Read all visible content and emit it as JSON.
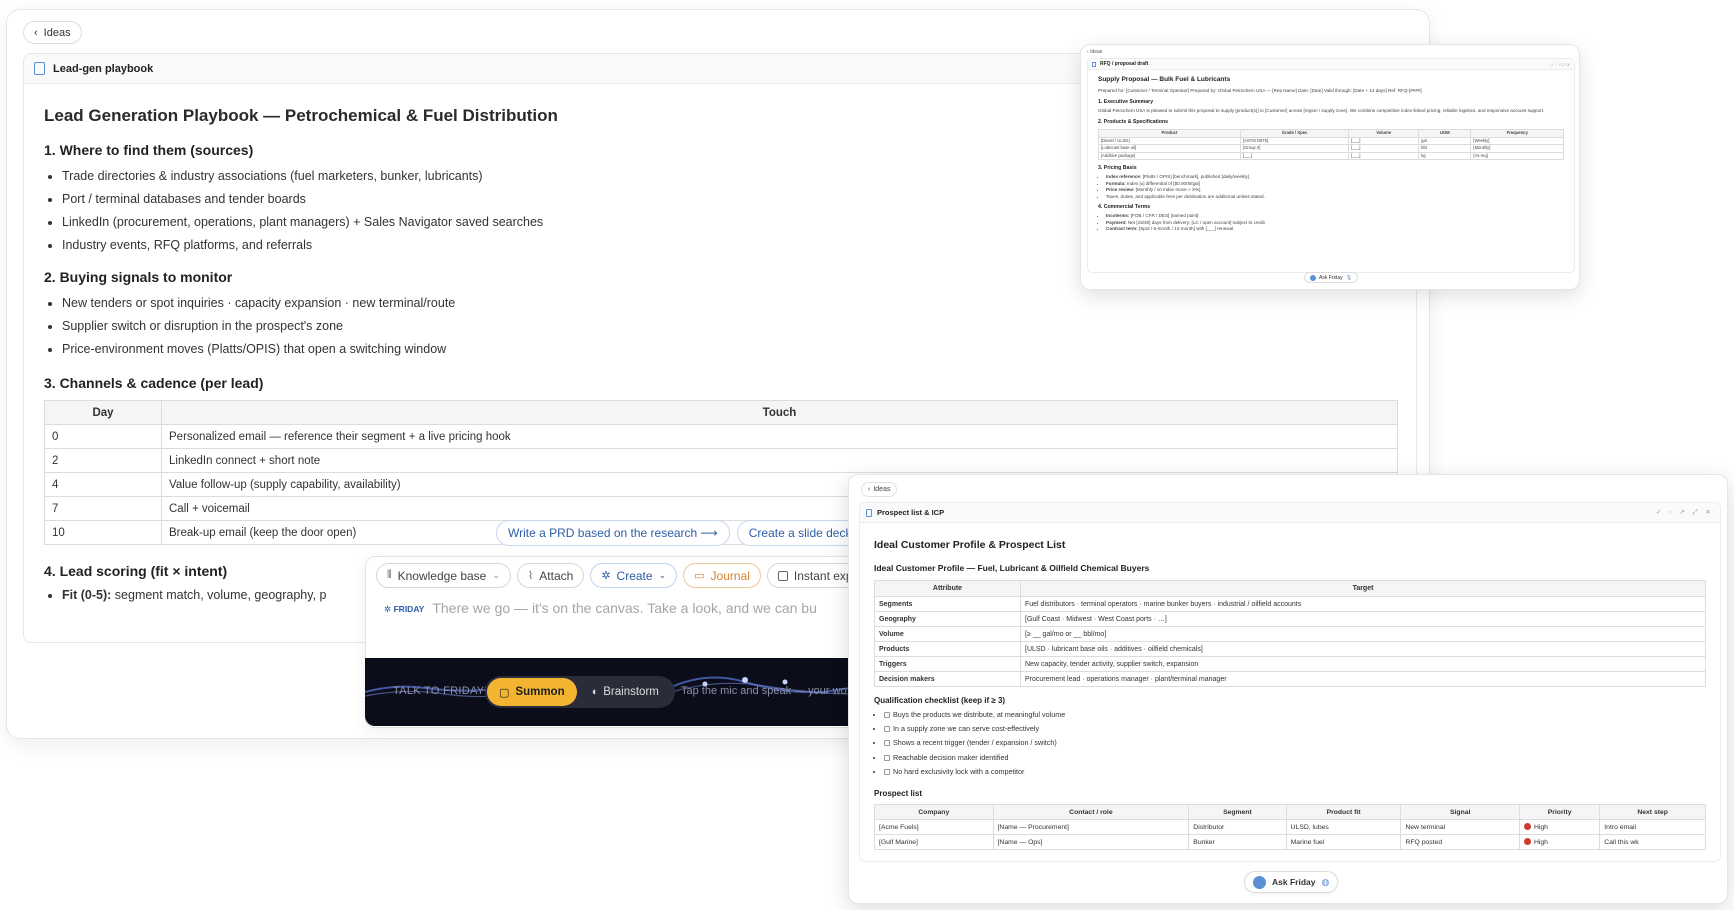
{
  "main": {
    "back_label": "Ideas",
    "doc_title": "Lead-gen playbook",
    "heading": "Lead Generation Playbook — Petrochemical & Fuel Distribution",
    "s1_title": "1. Where to find them (sources)",
    "s1_items": [
      "Trade directories & industry associations (fuel marketers, bunker, lubricants)",
      "Port / terminal databases and tender boards",
      "LinkedIn (procurement, operations, plant managers) + Sales Navigator saved searches",
      "Industry events, RFQ platforms, and referrals"
    ],
    "s2_title": "2. Buying signals to monitor",
    "s2_items": [
      "New tenders or spot inquiries · capacity expansion · new terminal/route",
      "Supplier switch or disruption in the prospect's zone",
      "Price-environment moves (Platts/OPIS) that open a switching window"
    ],
    "s3_title": "3. Channels & cadence (per lead)",
    "cad_head": {
      "day": "Day",
      "touch": "Touch"
    },
    "cad_rows": [
      {
        "day": "0",
        "touch": "Personalized email — reference their segment + a live pricing hook"
      },
      {
        "day": "2",
        "touch": "LinkedIn connect + short note"
      },
      {
        "day": "4",
        "touch": "Value follow-up (supply capability, availability)"
      },
      {
        "day": "7",
        "touch": "Call + voicemail"
      },
      {
        "day": "10",
        "touch": "Break-up email (keep the door open)"
      }
    ],
    "s4_title": "4. Lead scoring (fit × intent)",
    "s4_fit_label": "Fit (0-5):",
    "s4_fit_text": " segment match, volume, geography, p"
  },
  "chat": {
    "suggestions": [
      "Write a PRD based on the research ⟶",
      "Create a slide deck from"
    ],
    "tools": [
      "Knowledge base",
      "Attach",
      "Create",
      "Journal",
      "Instant explain"
    ],
    "friday_label": "FRIDAY",
    "message": "There we go — it's on the canvas. Take a look, and we can bu",
    "talk_hint": "TALK TO FRIDAY!",
    "summon_label": "Summon",
    "brainstorm_label": "Brainstorm",
    "tap_hint": "Tap the mic and speak — your wo"
  },
  "rfq": {
    "back_label": "Ideas",
    "title": "RFQ / proposal draft",
    "heading": "Supply Proposal — Bulk Fuel & Lubricants",
    "meta": "Prepared for: [Customer / Terminal Operator]  Prepared by: Global Petrochem USA — [Rep Name]  Date: [Date]  Valid through: [Date + 14 days]  Ref: RFQ-[####]",
    "h1": "1. Executive Summary",
    "p1": "Global Petrochem USA is pleased to submit this proposal to supply [product(s)] to [Customer] across [region / supply zone]. We combine competitive index-linked pricing, reliable logistics, and responsive account support.",
    "h2": "2. Products & Specifications",
    "table_head": [
      "Product",
      "Grade / Spec",
      "Volume",
      "UOM",
      "Frequency"
    ],
    "table_rows": [
      [
        "[Diesel / ULSD]",
        "[ASTM D975]",
        "[___]",
        "gal",
        "[Weekly]"
      ],
      [
        "[Lubricant base oil]",
        "[Group II]",
        "[___]",
        "bbl",
        "[Monthly]"
      ],
      [
        "[Additive package]",
        "[___]",
        "[___]",
        "kg",
        "[As req]"
      ]
    ],
    "h3": "3. Pricing Basis",
    "pricing": [
      {
        "k": "Index reference:",
        "v": " [Platts / OPIS] [benchmark], published [daily/weekly]"
      },
      {
        "k": "Formula:",
        "v": " Index [±] differential of [$0.0000/gal]"
      },
      {
        "k": "Price review:",
        "v": " [Monthly / on index move > X%]"
      },
      {
        "k": "",
        "v": "Taxes, duties, and applicable fees per destination are additional unless stated."
      }
    ],
    "h4": "4. Commercial Terms",
    "terms": [
      {
        "k": "Incoterms:",
        "v": " [FOB / CFR / DES] [named point]"
      },
      {
        "k": "Payment:",
        "v": " Net [15/30] days from delivery; [LC / open account] subject to credit"
      },
      {
        "k": "Contract term:",
        "v": " [Spot / 6-month / 12-month] with [___] renewal"
      }
    ],
    "ask_label": "Ask Friday"
  },
  "icp": {
    "back_label": "Ideas",
    "title": "Prospect list & ICP",
    "heading": "Ideal Customer Profile & Prospect List",
    "subheading": "Ideal Customer Profile — Fuel, Lubricant & Oilfield Chemical Buyers",
    "attr_head": [
      "Attribute",
      "Target"
    ],
    "attr_rows": [
      [
        "Segments",
        "Fuel distributors · terminal operators · marine bunker buyers · industrial / oilfield accounts"
      ],
      [
        "Geography",
        "[Gulf Coast · Midwest · West Coast ports · …]"
      ],
      [
        "Volume",
        "[≥ __ gal/mo or __ bbl/mo]"
      ],
      [
        "Products",
        "[ULSD · lubricant base oils · additives · oilfield chemicals]"
      ],
      [
        "Triggers",
        "New capacity, tender activity, supplier switch, expansion"
      ],
      [
        "Decision makers",
        "Procurement lead · operations manager · plant/terminal manager"
      ]
    ],
    "checklist_title": "Qualification checklist (keep if ≥ 3)",
    "checklist": [
      "Buys the products we distribute, at meaningful volume",
      "In a supply zone we can serve cost-effectively",
      "Shows a recent trigger (tender / expansion / switch)",
      "Reachable decision maker identified",
      "No hard exclusivity lock with a competitor"
    ],
    "prospect_title": "Prospect list",
    "prospect_head": [
      "Company",
      "Contact / role",
      "Segment",
      "Product fit",
      "Signal",
      "Priority",
      "Next step"
    ],
    "prospect_rows": [
      [
        "[Acme Fuels]",
        "[Name — Procurement]",
        "Distributor",
        "ULSD, lubes",
        "New terminal",
        "High",
        "Intro email"
      ],
      [
        "[Gulf Marine]",
        "[Name — Ops]",
        "Bunker",
        "Marine fuel",
        "RFQ posted",
        "High",
        "Call this wk"
      ]
    ],
    "ask_label": "Ask Friday"
  },
  "colors": {
    "accent": "#2d5ea6",
    "summon": "#f3b531",
    "priority_high": "#d13a2b",
    "journal": "#d9822b"
  }
}
